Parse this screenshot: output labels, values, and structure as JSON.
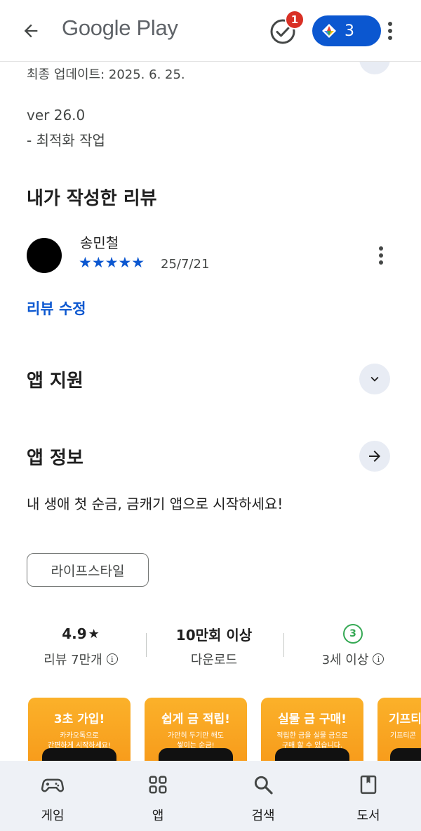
{
  "header": {
    "title": "Google Play",
    "task_badge": "1",
    "points": "3"
  },
  "details": {
    "updated": "최종 업데이트: 2025. 6. 25.",
    "version": "ver 26.0",
    "note": "- 최적화 작업"
  },
  "my_review": {
    "heading": "내가 작성한 리뷰",
    "reviewer": "송민철",
    "stars": "★★★★★",
    "rating": 5,
    "date": "25/7/21",
    "edit_label": "리뷰 수정"
  },
  "app_support": {
    "heading": "앱 지원"
  },
  "app_info": {
    "heading": "앱 정보",
    "description": "내 생애 첫 순금, 금캐기 앱으로 시작하세요!",
    "category": "라이프스타일"
  },
  "stats": {
    "rating_value": "4.9",
    "rating_star": "★",
    "reviews_label": "리뷰 7만개",
    "downloads_value": "10만회 이상",
    "downloads_label": "다운로드",
    "age_value": "3",
    "age_label": "3세 이상"
  },
  "screenshots": [
    {
      "title": "3초 가입!",
      "subtitle": "카카오톡으로\n간편하게 시작하세요!"
    },
    {
      "title": "쉽게 금 적립!",
      "subtitle": "가만히 두기만 해도\n쌓이는 순금!"
    },
    {
      "title": "실물 금 구매!",
      "subtitle": "적립한 금을 실물 금으로\n구매 할 수 있습니다."
    },
    {
      "title": "기프티",
      "subtitle": "기프티콘"
    }
  ],
  "bottom_nav": {
    "games": "게임",
    "apps": "앱",
    "search": "검색",
    "books": "도서"
  },
  "colors": {
    "accent": "#0b57d0",
    "badge": "#d93025",
    "age_rating": "#34a853",
    "screenshot_bg": "#f9a825"
  },
  "icons": [
    "back-arrow-icon",
    "task-check-icon",
    "play-points-icon",
    "more-vert-icon",
    "chevron-down-icon",
    "arrow-right-icon",
    "info-icon",
    "gamepad-icon",
    "apps-grid-icon",
    "search-icon",
    "book-icon"
  ]
}
